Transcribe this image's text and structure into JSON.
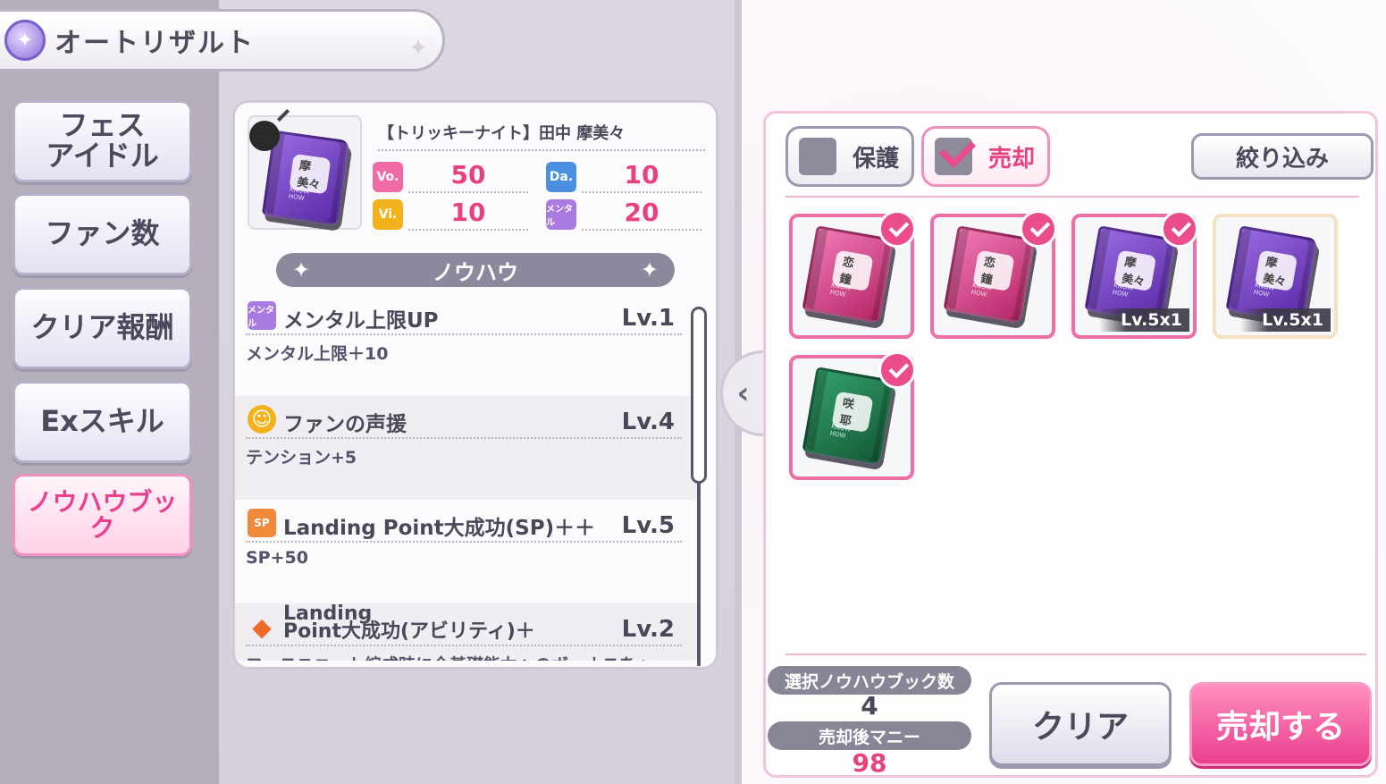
{
  "title": {
    "text": "オートリザルト"
  },
  "sidebar": {
    "items": [
      {
        "label": "フェス\nアイドル"
      },
      {
        "label": "ファン数"
      },
      {
        "label": "クリア報酬"
      },
      {
        "label": "Exスキル"
      },
      {
        "label": "ノウハウブック",
        "active": true
      }
    ]
  },
  "detail": {
    "card_name": "【トリッキーナイト】田中 摩美々",
    "book_label": "摩美々",
    "book_sub": "KNOW HOW",
    "stats": [
      {
        "label": "Vo.",
        "value": "50",
        "color": "#f06aa6"
      },
      {
        "label": "Da.",
        "value": "10",
        "color": "#4a8fe0"
      },
      {
        "label": "Vi.",
        "value": "10",
        "color": "#f2b21c"
      },
      {
        "label": "メンタル",
        "value": "20",
        "color": "#a97be0"
      }
    ],
    "knowhow_header": "ノウハウ",
    "skills": [
      {
        "icon": "メンタル",
        "icon_color": "#a97be0",
        "name": "メンタル上限UP",
        "level": "Lv.1",
        "desc": "メンタル上限＋10"
      },
      {
        "icon": "☺",
        "icon_color": "#f2b21c",
        "name": "ファンの声援",
        "level": "Lv.4",
        "desc": "テンション+5"
      },
      {
        "icon": "SP",
        "icon_color": "#f08a3a",
        "name": "Landing Point大成功(SP)＋＋",
        "level": "Lv.5",
        "desc": "SP+50"
      },
      {
        "icon": "◆",
        "icon_color": "#f06a2a",
        "name_line1": "Landing",
        "name_line2": "Point大成功(アビリティ)＋",
        "level": "Lv.2",
        "desc": "フェスユニット編成時に全基礎能力へのボーナスを+"
      }
    ]
  },
  "inventory": {
    "protect_label": "保護",
    "sell_label": "売却",
    "filter_label": "絞り込み",
    "items": [
      {
        "book": "恋鐘",
        "color": "pink",
        "selected": true,
        "level": ""
      },
      {
        "book": "恋鐘",
        "color": "pink",
        "selected": true,
        "level": ""
      },
      {
        "book": "摩美々",
        "color": "purple",
        "selected": true,
        "level": "Lv.5x1"
      },
      {
        "book": "摩美々",
        "color": "purple",
        "selected": false,
        "level": "Lv.5x1"
      },
      {
        "book": "咲耶",
        "color": "green",
        "selected": true,
        "level": ""
      }
    ],
    "book_sub": "KNOW HOW",
    "selected_count_label": "選択ノウハウブック数",
    "selected_count": "4",
    "money_label": "売却後マニー",
    "money": "98",
    "clear_label": "クリア",
    "sell_button_label": "売却する"
  },
  "colors": {
    "accent_pink": "#ea3f8e",
    "money": "#e8427e"
  }
}
